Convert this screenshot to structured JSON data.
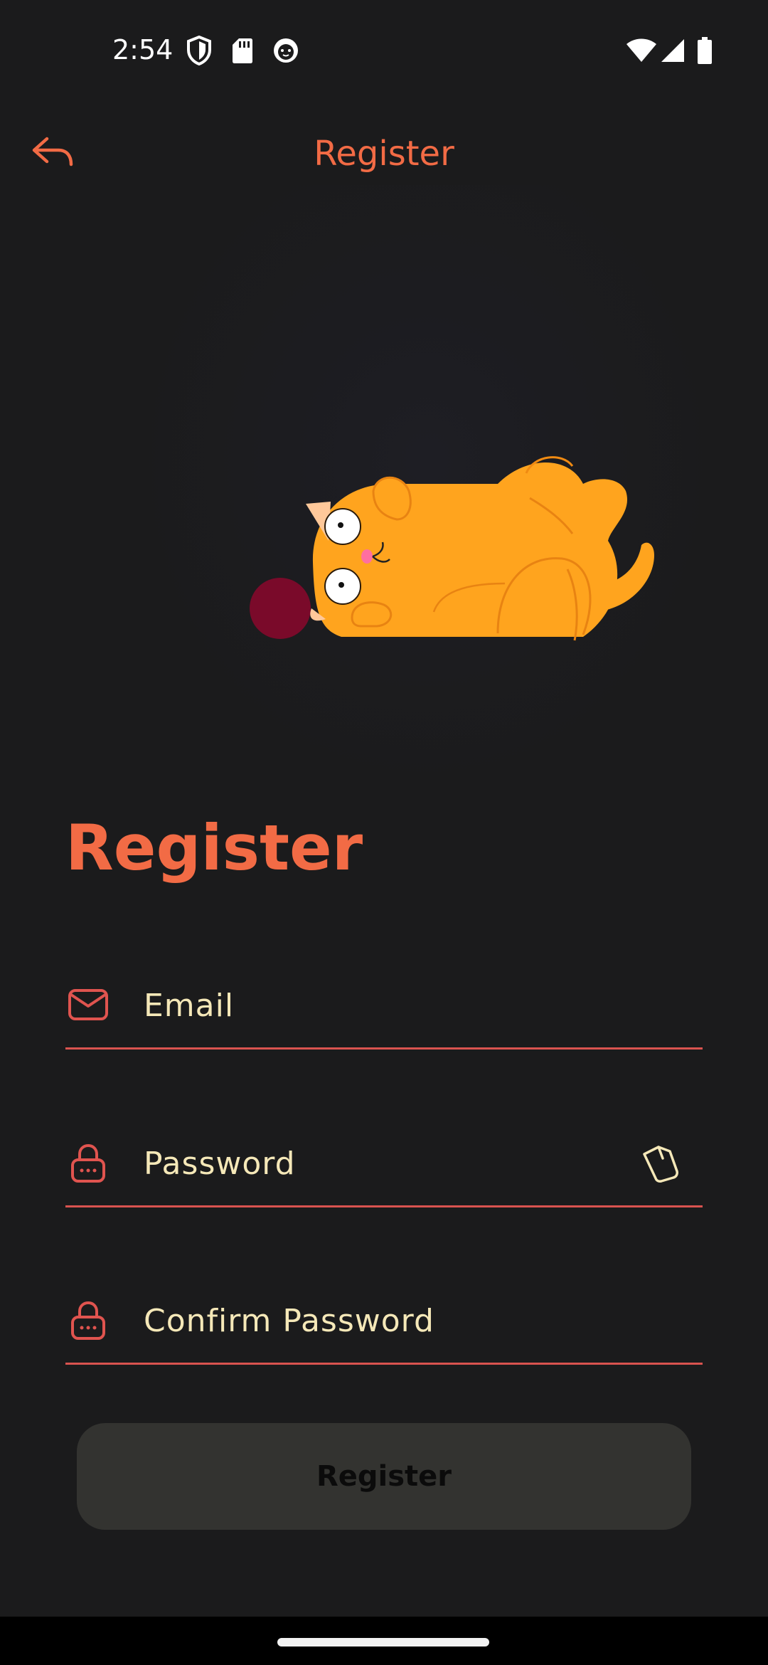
{
  "status_bar": {
    "time": "2:54",
    "left_icons": [
      "shield-icon",
      "sd-card-icon",
      "cat-face-icon"
    ],
    "right_icons": [
      "wifi-icon",
      "signal-icon",
      "battery-icon"
    ]
  },
  "app_bar": {
    "title": "Register",
    "back_icon": "reply-arrow-icon"
  },
  "hero": {
    "illustration": "cat-playing-with-ball"
  },
  "form": {
    "heading": "Register",
    "email": {
      "placeholder": "Email",
      "value": "",
      "icon": "mail-icon"
    },
    "password": {
      "placeholder": "Password",
      "value": "",
      "icon": "lock-icon",
      "toggle_icon": "visibility-toggle-icon"
    },
    "confirm_password": {
      "placeholder": "Confirm Password",
      "value": "",
      "icon": "lock-icon"
    },
    "submit_label": "Register"
  },
  "colors": {
    "accent": "#f26b45",
    "field_underline": "#d9534f",
    "input_text": "#f5e8b8",
    "background": "#1b1b1c",
    "button_bg": "#333330"
  }
}
